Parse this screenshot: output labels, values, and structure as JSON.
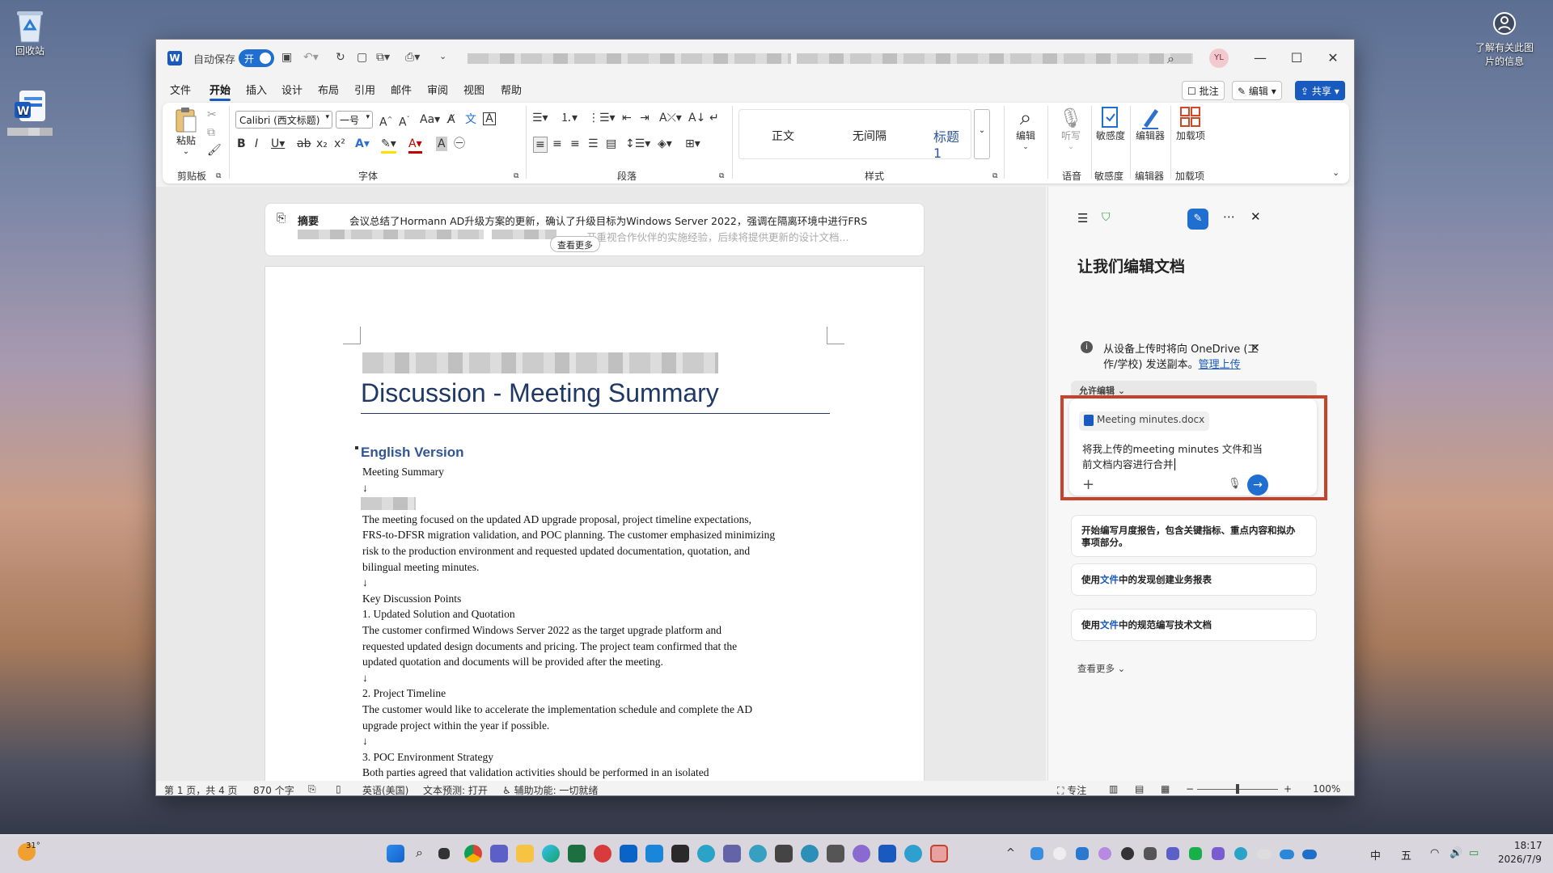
{
  "desktop": {
    "recycle_label": "回收站",
    "spotlight_label_1": "了解有关此图",
    "spotlight_label_2": "片的信息"
  },
  "titlebar": {
    "autosave_label": "自动保存",
    "toggle_label": "开",
    "avatar": "YL"
  },
  "menu": {
    "items": [
      "文件",
      "开始",
      "插入",
      "设计",
      "布局",
      "引用",
      "邮件",
      "审阅",
      "视图",
      "帮助"
    ],
    "active_index": 1
  },
  "ribbon_actions": {
    "comment": "批注",
    "edit": "编辑",
    "share": "共享"
  },
  "ribbon": {
    "clipboard": {
      "paste": "粘贴",
      "label": "剪贴板"
    },
    "font": {
      "family": "Calibri (西文标题)",
      "size": "一号",
      "label": "字体"
    },
    "paragraph": {
      "label": "段落"
    },
    "styles": {
      "items": [
        "正文",
        "无间隔",
        "标题 1"
      ],
      "label": "样式"
    },
    "editing": {
      "label": "编辑"
    },
    "voice": {
      "dictate": "听写",
      "label": "语音"
    },
    "sensitivity": {
      "btn": "敏感度",
      "label": "敏感度"
    },
    "editor": {
      "btn": "编辑器",
      "label": "编辑器"
    },
    "addins": {
      "btn": "加载项",
      "label": "加载项"
    }
  },
  "summary": {
    "label": "摘要",
    "line1": "会议总结了Hormann AD升级方案的更新，确认了升级目标为Windows Server 2022，强调在隔离环境中进行FRS",
    "line2": "开重视合作伙伴的实施经验，后续将提供更新的设计文档...",
    "see_more": "查看更多"
  },
  "document": {
    "title": "Discussion - Meeting Summary",
    "heading": "English Version",
    "lines": [
      "Meeting Summary",
      "",
      "",
      "The meeting focused on the updated AD upgrade proposal, project timeline expectations,",
      "FRS-to-DFSR migration validation, and POC planning. The customer emphasized minimizing",
      "risk to the production environment and requested updated documentation, quotation, and",
      "bilingual meeting minutes.",
      "",
      "Key Discussion Points",
      "1. Updated Solution and Quotation",
      "The customer confirmed Windows Server 2022 as the target upgrade platform and",
      "requested updated design documents and pricing. The project team confirmed that the",
      "updated quotation and documents will be provided after the meeting.",
      "",
      "2. Project Timeline",
      "The customer would like to accelerate the implementation schedule and complete the AD",
      "upgrade project within the year if possible.",
      "",
      "3. POC Environment Strategy",
      "Both parties agreed that validation activities should be performed in an isolated"
    ]
  },
  "copilot": {
    "heading": "让我们编辑文档",
    "notice_1": "从设备上传时将向 OneDrive (工",
    "notice_2": "作/学校) 发送副本。",
    "notice_link": "管理上传",
    "allow_edit": "允许编辑",
    "file_chip": "Meeting minutes.docx",
    "prompt_1": "将我上传的meeting minutes 文件和当",
    "prompt_2": "前文档内容进行合并",
    "s1_line1": "开始编写月度报告，包含关键指标、重点内容和拟办",
    "s1_line2": "事项部分。",
    "s2_pre": "使用",
    "s2_link": "文件",
    "s2_post": "中的发现创建业务报表",
    "s3_pre": "使用",
    "s3_link": "文件",
    "s3_post": "中的规范编写技术文档",
    "see_more": "查看更多"
  },
  "status": {
    "page": "第 1 页，共 4 页",
    "words": "870 个字",
    "lang": "英语(美国)",
    "predict": "文本预测: 打开",
    "access": "辅助功能: 一切就绪",
    "focus": "专注",
    "zoom": "100%"
  },
  "taskbar": {
    "weather": "31°",
    "ime": "中",
    "ime2": "五",
    "time": "18:17",
    "date": "2026/7/9"
  },
  "colors": {
    "accent": "#185abd",
    "title_blue": "#1f3864",
    "heading_blue": "#2f5597",
    "highlight_red": "#c8432b"
  }
}
